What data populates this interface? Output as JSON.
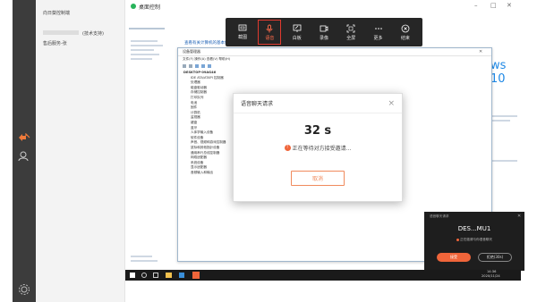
{
  "window": {
    "title": "桌面控制",
    "controls": [
      "–",
      "□",
      "✕"
    ]
  },
  "contacts": {
    "items": [
      {
        "name": "向日葵控制端",
        "sub": ""
      },
      {
        "name": "",
        "sub": "(技术支持)"
      },
      {
        "name": "售后服务-张",
        "sub": ""
      }
    ]
  },
  "toolbar": {
    "buttons": [
      {
        "label": "截图",
        "icon": "screen-icon"
      },
      {
        "label": "语音",
        "icon": "mic-icon",
        "active": true
      },
      {
        "label": "白板",
        "icon": "whiteboard-icon"
      },
      {
        "label": "录像",
        "icon": "record-icon"
      },
      {
        "label": "全屏",
        "icon": "fullscreen-icon"
      },
      {
        "label": "更多",
        "icon": "more-icon"
      },
      {
        "label": "结束",
        "icon": "end-icon"
      }
    ]
  },
  "remote": {
    "link_text": "查看有关计算机的基本信息",
    "brand_text": "ws 10",
    "devmgr_title": "设备管理器",
    "devmgr_menu": "文件(F) 操作(A) 查看(V) 帮助(H)",
    "tree_root": "DESKTOP-09AG46",
    "tree_items": [
      "IDE ATA/ATAPI 控制器",
      "处理器",
      "磁盘驱动器",
      "存储控制器",
      "打印队列",
      "电池",
      "固件",
      "计算机",
      "监视器",
      "键盘",
      "蓝牙",
      "人体学输入设备",
      "软件设备",
      "声音、视频和游戏控制器",
      "鼠标和其他指针设备",
      "通用串行总线控制器",
      "网络适配器",
      "系统设备",
      "显示适配器",
      "音频输入和输出"
    ]
  },
  "dialog": {
    "title": "语音聊天请求",
    "timer": "32 s",
    "message": "正在等待对方接受邀请...",
    "cancel": "取消",
    "close": "×"
  },
  "notification": {
    "header": "语音聊天请求",
    "name": "DES...MU1",
    "subtitle": "正在邀请与你语音聊天",
    "accept": "接受",
    "decline": "拒绝(30s)"
  },
  "taskbar": {
    "time": "14:36",
    "date": "2020/11/24"
  },
  "colors": {
    "accent": "#e03a2f",
    "orange": "#f08a5d",
    "rail": "#3c3c3c",
    "toolbar": "#262626"
  }
}
